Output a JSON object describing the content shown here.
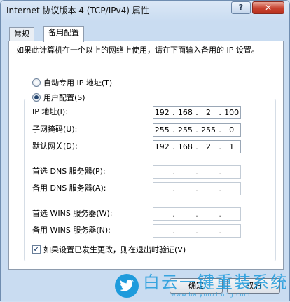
{
  "window": {
    "title": "Internet 协议版本 4 (TCP/IPv4) 属性",
    "help_label": "?",
    "close_label": "✕"
  },
  "tabs": [
    {
      "label": "常规",
      "active": false
    },
    {
      "label": "备用配置",
      "active": true
    }
  ],
  "description": "如果此计算机在一个以上的网络上使用，请在下面输入备用的 IP 设置。",
  "options": {
    "auto_private": {
      "label": "自动专用 IP 地址(T)",
      "selected": false
    },
    "user_config": {
      "label": "用户配置(S)",
      "selected": true
    }
  },
  "fields": {
    "ip": {
      "label": "IP 地址(I):",
      "octets": [
        "192",
        "168",
        "2",
        "100"
      ]
    },
    "mask": {
      "label": "子网掩码(U):",
      "octets": [
        "255",
        "255",
        "255",
        "0"
      ]
    },
    "gateway": {
      "label": "默认网关(D):",
      "octets": [
        "192",
        "168",
        "2",
        "1"
      ]
    },
    "dns_primary": {
      "label": "首选 DNS 服务器(P):",
      "octets": [
        "",
        "",
        "",
        ""
      ]
    },
    "dns_alt": {
      "label": "备用 DNS 服务器(A):",
      "octets": [
        "",
        "",
        "",
        ""
      ]
    },
    "wins_primary": {
      "label": "首选 WINS 服务器(W):",
      "octets": [
        "",
        "",
        "",
        ""
      ]
    },
    "wins_alt": {
      "label": "备用 WINS 服务器(N):",
      "octets": [
        "",
        "",
        "",
        ""
      ]
    }
  },
  "validate": {
    "label": "如果设置已发生更改，则在退出时验证(V)",
    "checked": true
  },
  "buttons": {
    "ok": "确定",
    "cancel": "取消"
  },
  "watermark": {
    "main": "白云一键重装系统",
    "sub": "www.baiyunxitong.com"
  },
  "colors": {
    "watermark": "#1e9bdc",
    "close": "#c8412f"
  }
}
